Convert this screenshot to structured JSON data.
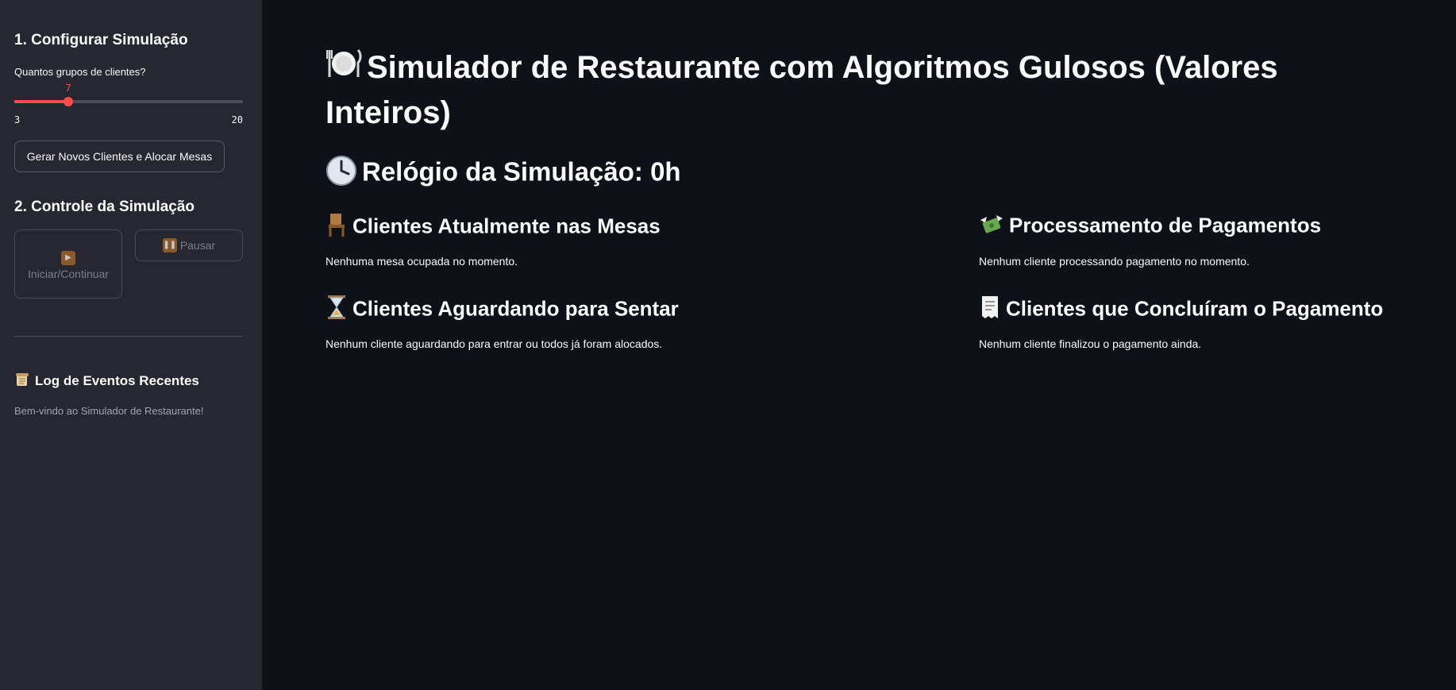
{
  "sidebar": {
    "config_heading": "1. Configurar Simulação",
    "groups_label": "Quantos grupos de clientes?",
    "slider": {
      "min": 3,
      "max": 20,
      "value": 7,
      "min_label": "3",
      "max_label": "20",
      "value_label": "7",
      "accent": "#ff4b4b"
    },
    "generate_button": "Gerar Novos Clientes e Alocar Mesas",
    "control_heading": "2. Controle da Simulação",
    "start_button": "Iniciar/Continuar",
    "pause_button": "Pausar",
    "log_heading": "Log de Eventos Recentes",
    "log_entries": [
      "Bem-vindo ao Simulador de Restaurante!"
    ]
  },
  "main": {
    "title": "Simulador de Restaurante com Algoritmos Gulosos (Valores Inteiros)",
    "clock": "Relógio da Simulação: 0h",
    "sections": {
      "tables": {
        "icon": "chair-icon",
        "heading": "Clientes Atualmente nas Mesas",
        "text": "Nenhuma mesa ocupada no momento."
      },
      "payments": {
        "icon": "money-wings-icon",
        "heading": "Processamento de Pagamentos",
        "text": "Nenhum cliente processando pagamento no momento."
      },
      "waiting": {
        "icon": "hourglass-icon",
        "heading": "Clientes Aguardando para Sentar",
        "text": "Nenhum cliente aguardando para entrar ou todos já foram alocados."
      },
      "paid": {
        "icon": "receipt-icon",
        "heading": "Clientes que Concluíram o Pagamento",
        "text": "Nenhum cliente finalizou o pagamento ainda."
      }
    }
  },
  "colors": {
    "background": "#0e1117",
    "sidebar": "#262730",
    "accent": "#ff4b4b",
    "text": "#fafafa"
  }
}
